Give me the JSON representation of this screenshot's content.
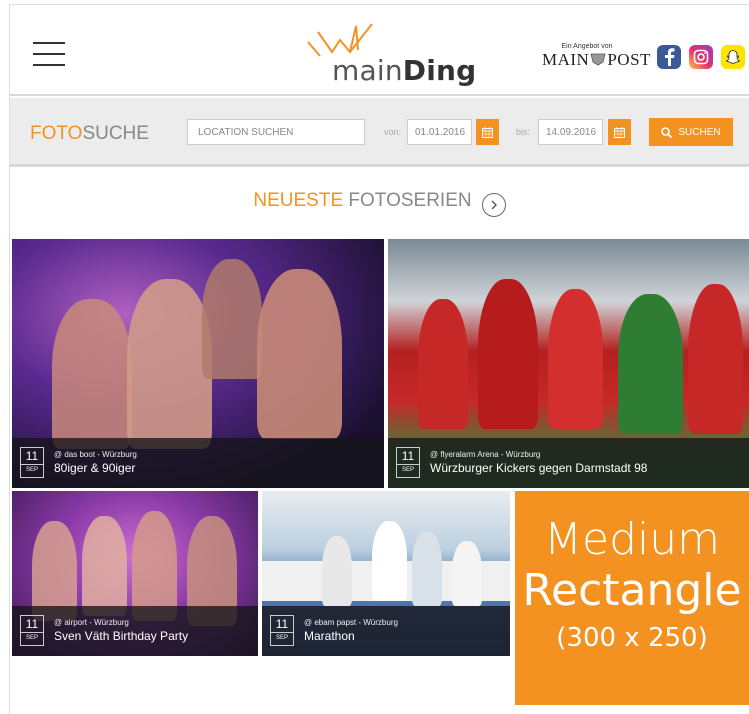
{
  "header": {
    "logo_light": "main",
    "logo_bold": "Ding",
    "partner_small": "Ein Angebot von",
    "partner_name_left": "MAIN",
    "partner_name_right": "POST",
    "social": [
      "facebook-icon",
      "instagram-icon",
      "snapchat-icon"
    ]
  },
  "search": {
    "title_accent": "FOTO",
    "title_rest": "SUCHE",
    "location_placeholder": "LOCATION SUCHEN",
    "from_label": "von:",
    "from_value": "01.01.2016",
    "to_label": "bis:",
    "to_value": "14.09.2016",
    "button_label": "SUCHEN"
  },
  "section": {
    "title_accent": "NEUESTE",
    "title_rest": " FOTOSERIEN"
  },
  "photos": [
    {
      "day": "11",
      "month": "SEP",
      "location": "@ das boot - Würzburg",
      "title": "80iger & 90iger"
    },
    {
      "day": "11",
      "month": "SEP",
      "location": "@ flyeralarm Arena - Würzburg",
      "title": "Würzburger Kickers gegen Darmstadt 98"
    },
    {
      "day": "11",
      "month": "SEP",
      "location": "@ airport - Würzburg",
      "title": "Sven Väth Birthday Party"
    },
    {
      "day": "11",
      "month": "SEP",
      "location": "@ ebam papst - Würzburg",
      "title": "Marathon"
    }
  ],
  "ad": {
    "line1": "Medium",
    "line2": "Rectangle",
    "line3": "(300 x 250)"
  },
  "colors": {
    "accent": "#f39220"
  }
}
